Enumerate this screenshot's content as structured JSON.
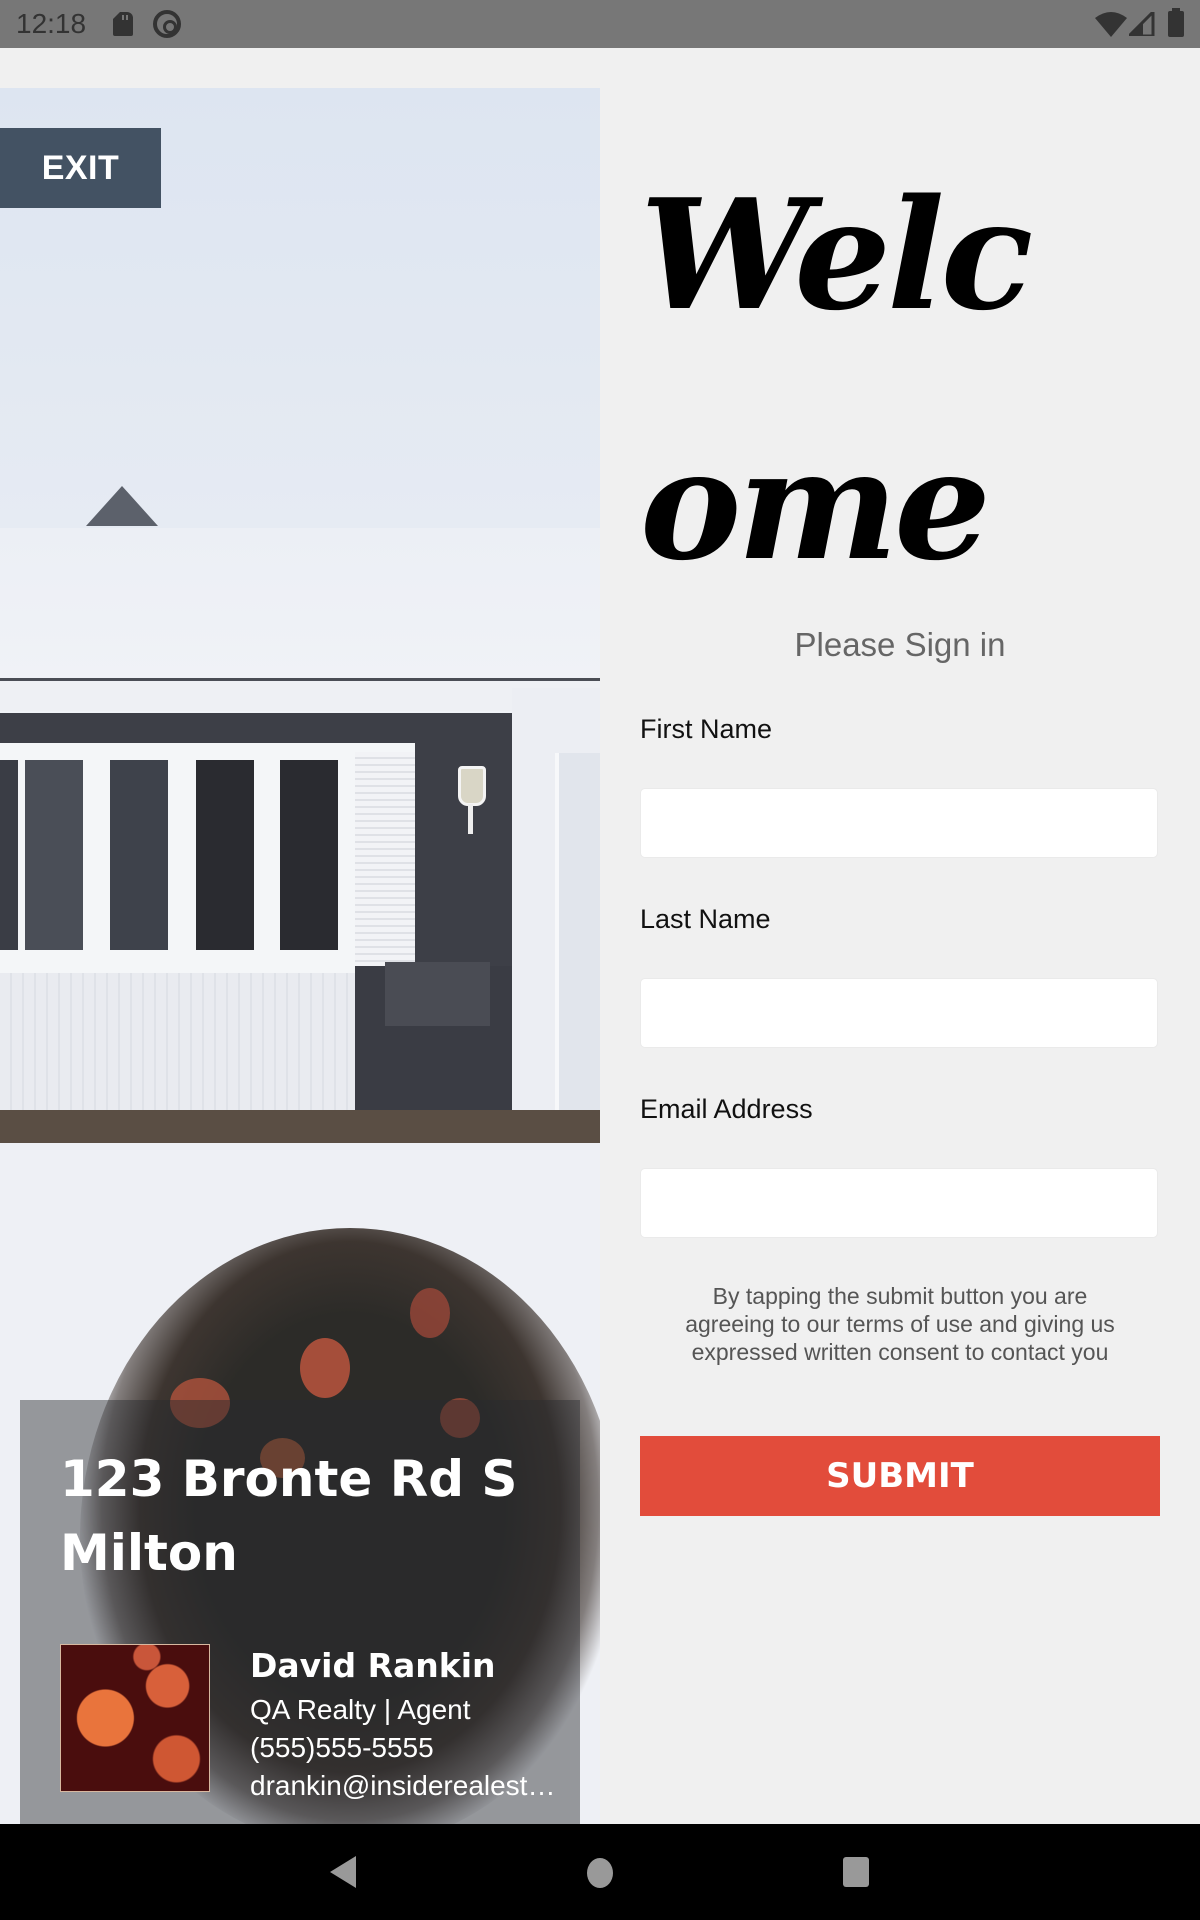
{
  "status_bar": {
    "time": "12:18",
    "icons": [
      "sd-card-icon",
      "q-icon",
      "wifi-icon",
      "signal-icon",
      "battery-icon"
    ]
  },
  "exit_button": {
    "label": "EXIT"
  },
  "listing": {
    "address_line1": "123 Bronte Rd S",
    "address_line2": "Milton",
    "agent": {
      "name": "David Rankin",
      "company_role": "QA Realty | Agent",
      "phone": "(555)555-5555",
      "email": "drankin@insiderealestat..."
    }
  },
  "form": {
    "welcome_title": "Welcome",
    "heading": "Please Sign in",
    "fields": [
      {
        "label": "First Name",
        "value": "",
        "placeholder": ""
      },
      {
        "label": "Last Name",
        "value": "",
        "placeholder": ""
      },
      {
        "label": "Email Address",
        "value": "",
        "placeholder": ""
      }
    ],
    "consent_text": "By tapping the submit button you are agreeing to our terms of use and giving us expressed written consent to contact you",
    "submit_label": "SUBMIT"
  },
  "colors": {
    "accent_submit": "#e24c3b",
    "exit_button": "#435263",
    "background": "#f0f0f0"
  },
  "nav_bar": {
    "buttons": [
      "back",
      "home",
      "recents"
    ]
  }
}
